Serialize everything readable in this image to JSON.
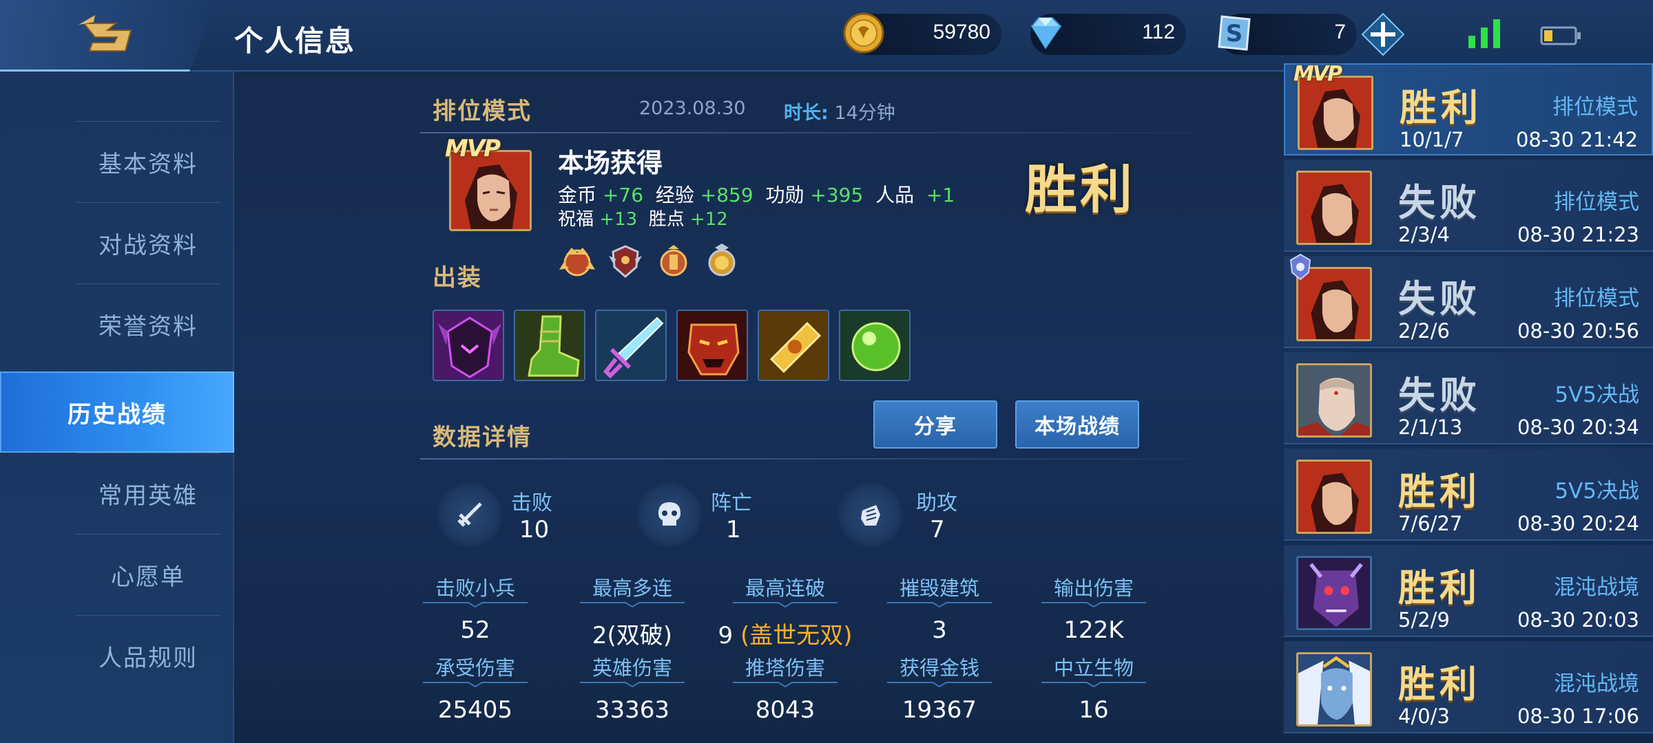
{
  "header": {
    "title": "个人信息",
    "back_icon": "back-arrow-icon",
    "currencies": [
      {
        "name": "gold-coin-icon",
        "value": "59780"
      },
      {
        "name": "diamond-icon",
        "value": "112"
      },
      {
        "name": "s-token-icon",
        "value": "7"
      }
    ],
    "signal_icon": "signal-icon",
    "battery_icon": "battery-icon"
  },
  "nav": {
    "items": [
      {
        "label": "基本资料"
      },
      {
        "label": "对战资料"
      },
      {
        "label": "荣誉资料"
      },
      {
        "label": "历史战绩"
      },
      {
        "label": "常用英雄"
      },
      {
        "label": "心愿单"
      },
      {
        "label": "人品规则"
      }
    ],
    "active_index": 3
  },
  "match": {
    "mode": "排位模式",
    "date": "2023.08.30",
    "duration_label": "时长:",
    "duration": "14分钟",
    "mvp": "MVP",
    "result": "胜利",
    "reward_title": "本场获得",
    "rewards_line1": [
      {
        "label": "金币",
        "value": "+76"
      },
      {
        "label": "经验",
        "value": "+859"
      },
      {
        "label": "功勋",
        "value": "+395"
      },
      {
        "label": "人品",
        "value": "+1"
      }
    ],
    "rewards_line2": [
      {
        "label": "祝福",
        "value": "+13"
      },
      {
        "label": "胜点",
        "value": "+12"
      }
    ],
    "equip_title": "出装",
    "details_title": "数据详情",
    "share_button": "分享",
    "match_stats_button": "本场战绩",
    "kda": [
      {
        "label": "击败",
        "value": "10",
        "icon": "kill-sword-icon"
      },
      {
        "label": "阵亡",
        "value": "1",
        "icon": "skull-icon"
      },
      {
        "label": "助攻",
        "value": "7",
        "icon": "assist-fist-icon"
      }
    ],
    "stats_row1": [
      {
        "label": "击败小兵",
        "value": "52"
      },
      {
        "label": "最高多连",
        "value": "2(双破)"
      },
      {
        "label": "最高连破",
        "value": "9",
        "extra": "(盖世无双)"
      },
      {
        "label": "摧毁建筑",
        "value": "3"
      },
      {
        "label": "输出伤害",
        "value": "122K"
      }
    ],
    "stats_row2": [
      {
        "label": "承受伤害",
        "value": "25405"
      },
      {
        "label": "英雄伤害",
        "value": "33363"
      },
      {
        "label": "推塔伤害",
        "value": "8043"
      },
      {
        "label": "获得金钱",
        "value": "19367"
      },
      {
        "label": "中立生物",
        "value": "16"
      }
    ]
  },
  "history": [
    {
      "result": "胜利",
      "win": true,
      "mode": "排位模式",
      "kda": "10/1/7",
      "time": "08-30 21:42",
      "mvp": "MVP"
    },
    {
      "result": "失败",
      "win": false,
      "mode": "排位模式",
      "kda": "2/3/4",
      "time": "08-30 21:23"
    },
    {
      "result": "失败",
      "win": false,
      "mode": "排位模式",
      "kda": "2/2/6",
      "time": "08-30 20:56"
    },
    {
      "result": "失败",
      "win": false,
      "mode": "5V5决战",
      "kda": "2/1/13",
      "time": "08-30 20:34"
    },
    {
      "result": "胜利",
      "win": true,
      "mode": "5V5决战",
      "kda": "7/6/27",
      "time": "08-30 20:24"
    },
    {
      "result": "胜利",
      "win": true,
      "mode": "混沌战境",
      "kda": "5/2/9",
      "time": "08-30 20:03"
    },
    {
      "result": "胜利",
      "win": true,
      "mode": "混沌战境",
      "kda": "4/0/3",
      "time": "08-30 17:06"
    }
  ],
  "colors": {
    "accent_blue": "#63b8f5",
    "gain_green": "#59e06a",
    "gold_text": "#f6d98a",
    "highlight_orange": "#ffae2a"
  }
}
